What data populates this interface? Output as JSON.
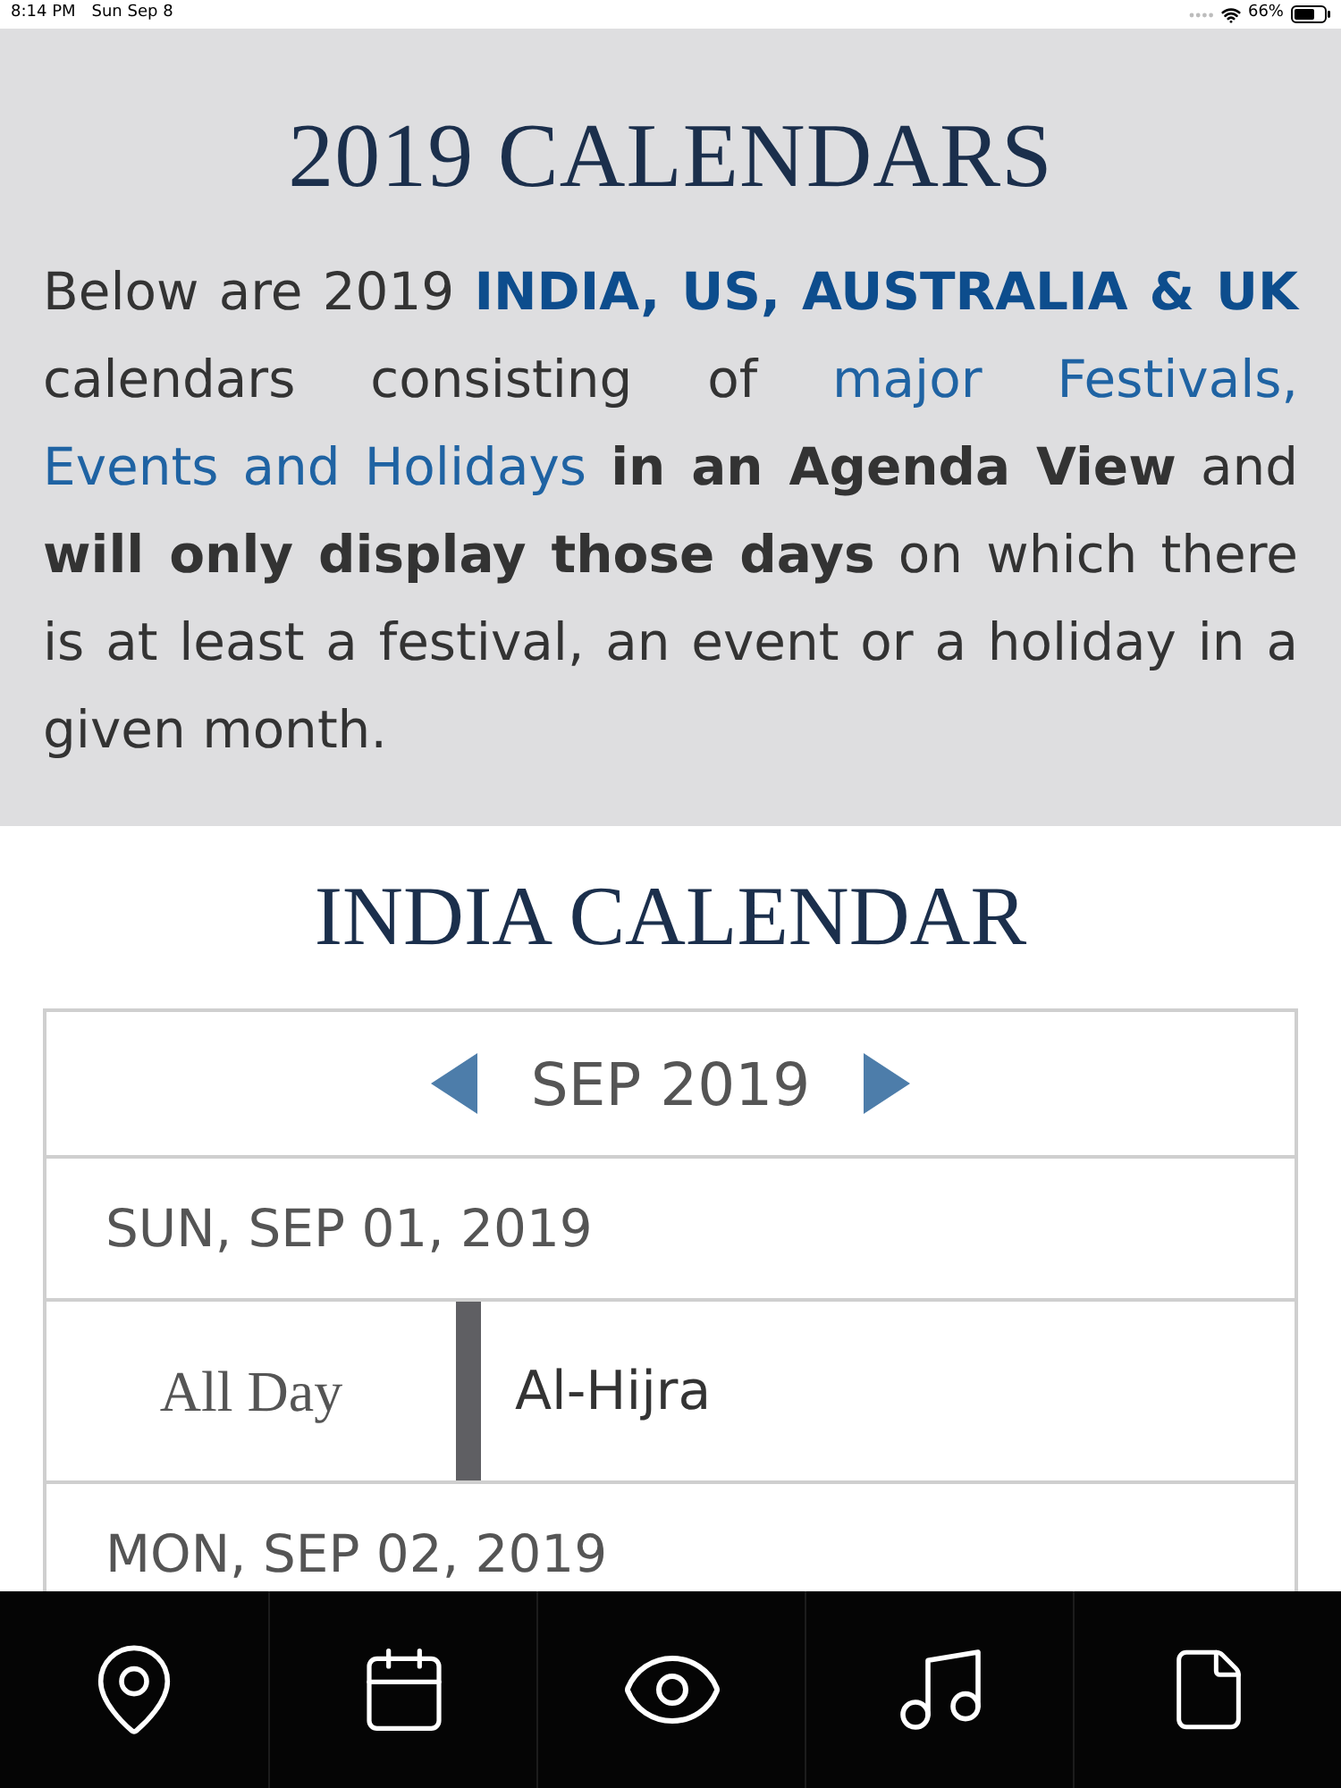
{
  "status_bar": {
    "time": "8:14 PM",
    "date": "Sun Sep 8",
    "battery": "66%"
  },
  "intro": {
    "title": "2019 CALENDARS",
    "paragraph": [
      {
        "kind": "text",
        "text": "Below are 2019"
      },
      {
        "kind": "highlight",
        "text": "INDIA, US, AUSTRALIA & UK"
      },
      {
        "kind": "text",
        "text": "calendars consisting of"
      },
      {
        "kind": "link",
        "text": "major Festivals,"
      },
      {
        "kind": "link",
        "text": "Events and Holidays"
      },
      {
        "kind": "bold",
        "text": "in an Agenda View"
      },
      {
        "kind": "text",
        "text": "and"
      },
      {
        "kind": "bold",
        "text": "will only display those days"
      },
      {
        "kind": "text",
        "text": "on which there is at least a festival, an event or a holiday in a given month."
      }
    ]
  },
  "calendar": {
    "title": "INDIA CALENDAR",
    "month": "SEP 2019",
    "days": [
      {
        "date": "SUN, SEP 01, 2019",
        "events": [
          {
            "time": "All Day",
            "name": "Al-Hijra"
          }
        ]
      },
      {
        "date": "MON, SEP 02, 2019"
      }
    ]
  }
}
